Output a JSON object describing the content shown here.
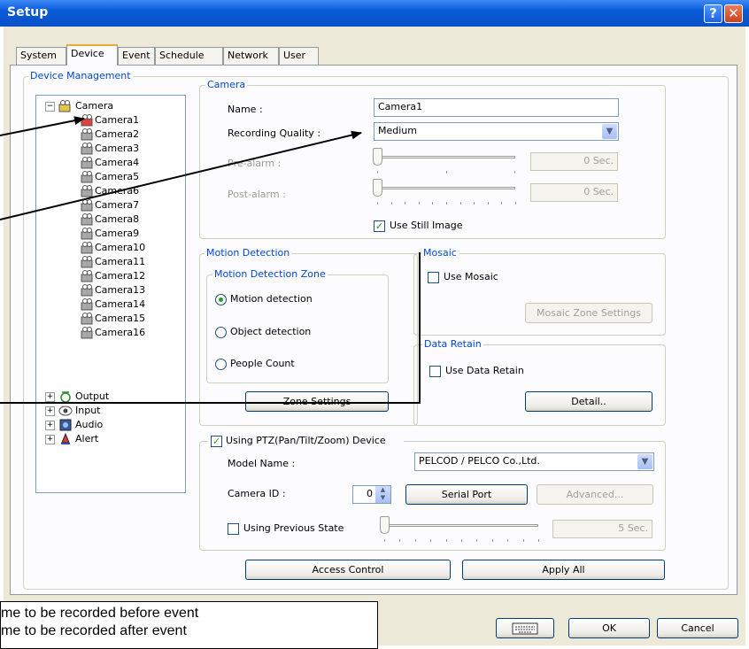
{
  "window": {
    "title": "Setup",
    "help_label": "?",
    "close_label": "✕"
  },
  "tabs": [
    "System",
    "Device",
    "Event",
    "Schedule",
    "Network",
    "User"
  ],
  "device_management": {
    "legend": "Device Management",
    "tree": {
      "root": "Camera",
      "cameras": [
        "Camera1",
        "Camera2",
        "Camera3",
        "Camera4",
        "Camera5",
        "Camera6",
        "Camera7",
        "Camera8",
        "Camera9",
        "Camera10",
        "Camera11",
        "Camera12",
        "Camera13",
        "Camera14",
        "Camera15",
        "Camera16"
      ],
      "others": [
        "Output",
        "Input",
        "Audio",
        "Alert"
      ]
    }
  },
  "camera": {
    "legend": "Camera",
    "name_label": "Name :",
    "name_value": "Camera1",
    "quality_label": "Recording Quality :",
    "quality_value": "Medium",
    "prealarm_label": "Pre-alarm :",
    "prealarm_value": "0 Sec.",
    "postalarm_label": "Post-alarm :",
    "postalarm_value": "0 Sec.",
    "still_label": "Use Still Image",
    "still_checked": true
  },
  "motion": {
    "legend": "Motion Detection",
    "zone_legend": "Motion Detection Zone",
    "options": [
      "Motion detection",
      "Object detection",
      "People Count"
    ],
    "selected": 0,
    "zone_button": "Zone Settings"
  },
  "mosaic": {
    "legend": "Mosaic",
    "use_label": "Use Mosaic",
    "zone_button": "Mosaic Zone Settings"
  },
  "retain": {
    "legend": "Data Retain",
    "use_label": "Use Data Retain",
    "detail_button": "Detail.."
  },
  "ptz": {
    "use_label": "Using PTZ(Pan/Tilt/Zoom) Device",
    "model_label": "Model Name :",
    "model_value": "PELCOD / PELCO Co.,Ltd.",
    "cameraid_label": "Camera ID :",
    "cameraid_value": "0",
    "serial_button": "Serial Port",
    "advanced_button": "Advanced...",
    "prev_label": "Using Previous State",
    "prev_value": "5 Sec."
  },
  "bottom": {
    "access_button": "Access Control",
    "apply_button": "Apply All",
    "ok_button": "OK",
    "cancel_button": "Cancel"
  },
  "callout": {
    "line1": "me to be recorded before event",
    "line2": "me to be recorded after event"
  },
  "colors": {
    "title_bar": "#0a5bd8",
    "legend_text": "#0046d5",
    "check_mark": "#21a121",
    "dialog_bg": "#ece9d8"
  }
}
